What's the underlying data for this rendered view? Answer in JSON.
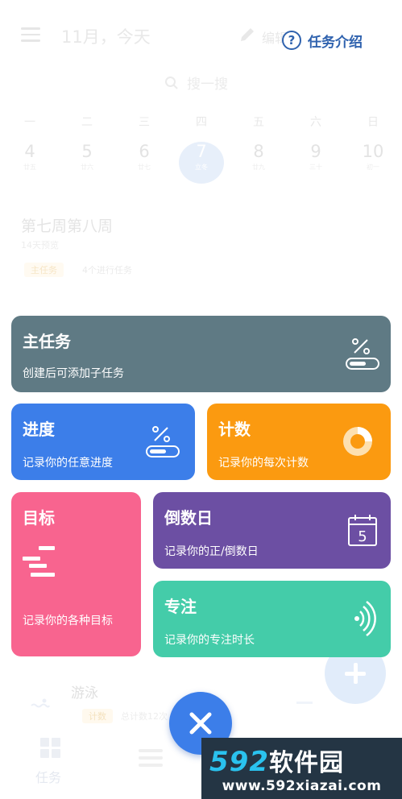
{
  "header": {
    "title": "11月，今天",
    "edit_label": "编辑",
    "intro_label": "任务介绍",
    "intro_icon": "help-circle-icon"
  },
  "search": {
    "placeholder": "搜一搜"
  },
  "week": [
    {
      "weekday": "一",
      "date": "4",
      "lunar": "廿五"
    },
    {
      "weekday": "二",
      "date": "5",
      "lunar": "廿六"
    },
    {
      "weekday": "三",
      "date": "6",
      "lunar": "廿七"
    },
    {
      "weekday": "四",
      "date": "7",
      "lunar": "立冬",
      "today": true
    },
    {
      "weekday": "五",
      "date": "8",
      "lunar": "廿九"
    },
    {
      "weekday": "六",
      "date": "9",
      "lunar": "三十"
    },
    {
      "weekday": "日",
      "date": "10",
      "lunar": "初一"
    }
  ],
  "period": {
    "title": "第七周第八周",
    "subtitle": "14天预览",
    "tag": "主任务",
    "active_count": "4个进行任务"
  },
  "task": {
    "name": "游泳",
    "tag": "计数",
    "count_text": "总计数12次"
  },
  "cards": {
    "main": {
      "title": "主任务",
      "desc": "创建后可添加子任务",
      "color": "#5f7a84",
      "icon": "percent-toggle-icon"
    },
    "progress": {
      "title": "进度",
      "desc": "记录你的任意进度",
      "color": "#3c7ee9",
      "icon": "percent-toggle-icon"
    },
    "count": {
      "title": "计数",
      "desc": "记录你的每次计数",
      "color": "#fb9a10",
      "icon": "counter-ring-icon"
    },
    "goal": {
      "title": "目标",
      "desc": "记录你的各种目标",
      "color": "#f8648f",
      "icon": "goal-bars-icon"
    },
    "countdown": {
      "title": "倒数日",
      "desc": "记录你的正/倒数日",
      "color": "#6c4fa3",
      "icon": "calendar-icon",
      "icon_number": "5"
    },
    "focus": {
      "title": "专注",
      "desc": "记录你的专注时长",
      "color": "#44cca9",
      "icon": "sound-wave-icon"
    }
  },
  "tabbar": {
    "tab1_label": "任务"
  },
  "watermark": {
    "brand_num": "592",
    "brand_text": "软件园",
    "url": "www.592xiazai.com"
  }
}
